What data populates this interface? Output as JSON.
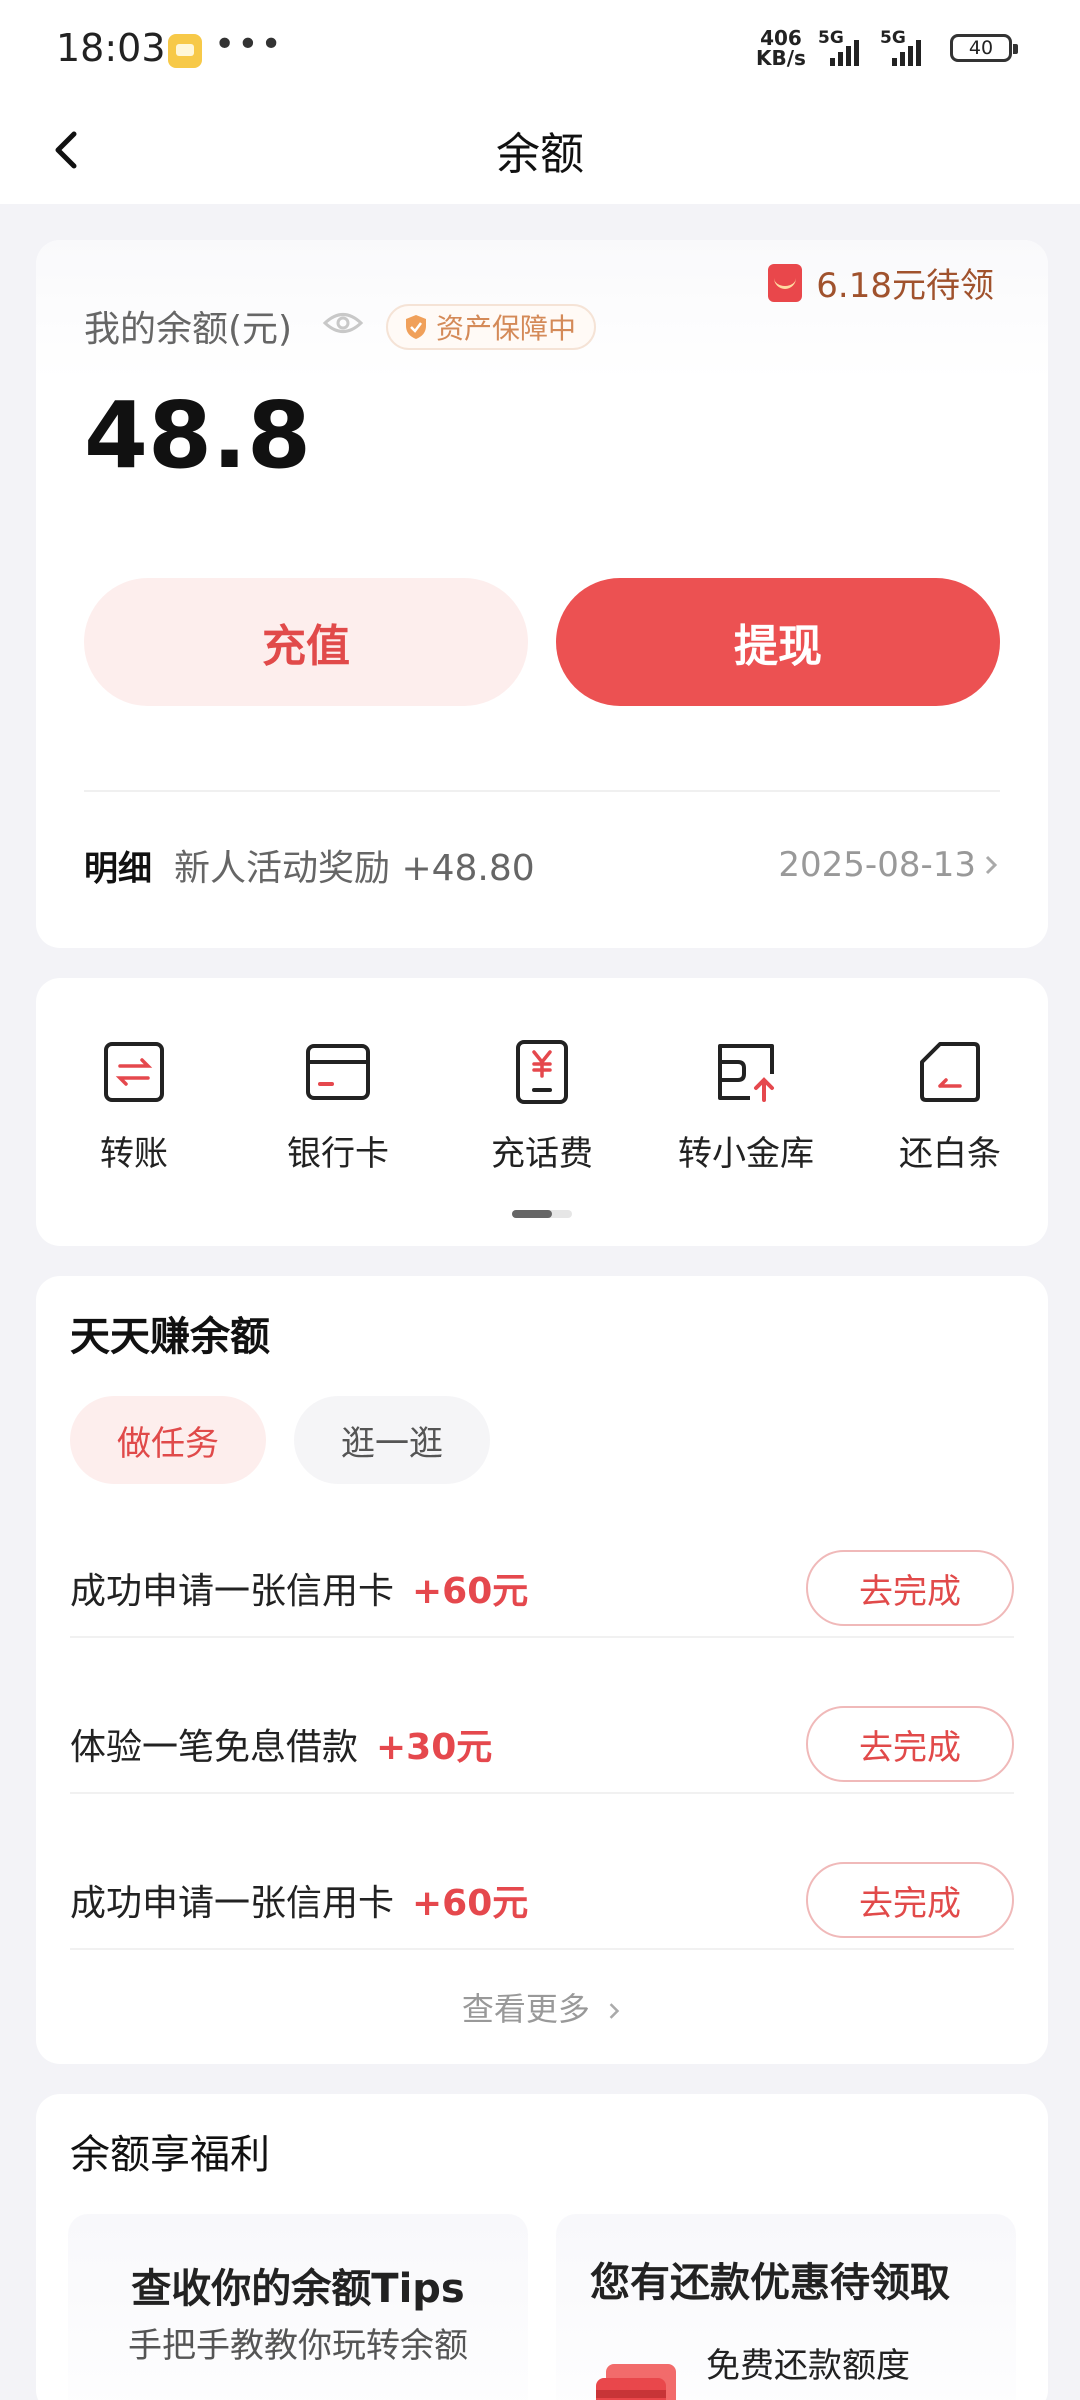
{
  "status_bar": {
    "time": "18:03",
    "more": "•••",
    "speed_value": "406",
    "speed_unit": "KB/s",
    "network_1": "5G",
    "network_2": "5G",
    "battery": "40"
  },
  "nav": {
    "title": "余额",
    "back_icon": "chevron-left-icon"
  },
  "balance": {
    "promo": "6.18元待领",
    "label": "我的余额(元)",
    "protect_badge": "资产保障中",
    "amount": "48.8",
    "recharge_label": "充值",
    "withdraw_label": "提现",
    "detail_label": "明细",
    "detail_desc": "新人活动奖励 +48.80",
    "detail_date": "2025-08-13",
    "accent_color": "#ec5152"
  },
  "shortcuts": [
    {
      "label": "转账",
      "icon": "transfer-icon"
    },
    {
      "label": "银行卡",
      "icon": "bank-card-icon"
    },
    {
      "label": "充话费",
      "icon": "phone-topup-icon"
    },
    {
      "label": "转小金库",
      "icon": "vault-transfer-icon"
    },
    {
      "label": "还白条",
      "icon": "repay-icon"
    }
  ],
  "earn": {
    "title": "天天赚余额",
    "tabs": [
      "做任务",
      "逛一逛"
    ],
    "tasks": [
      {
        "name": "成功申请一张信用卡",
        "reward": "+60元",
        "action": "去完成"
      },
      {
        "name": "体验一笔免息借款",
        "reward": "+30元",
        "action": "去完成"
      },
      {
        "name": "成功申请一张信用卡",
        "reward": "+60元",
        "action": "去完成"
      }
    ],
    "see_more": "查看更多"
  },
  "benefits": {
    "title": "余额享福利",
    "tips_title": "查收你的余额Tips",
    "tips_sub": "手把手教教你玩转余额",
    "coupon_title": "您有还款优惠待领取",
    "coupon_sub": "免费还款额度"
  }
}
